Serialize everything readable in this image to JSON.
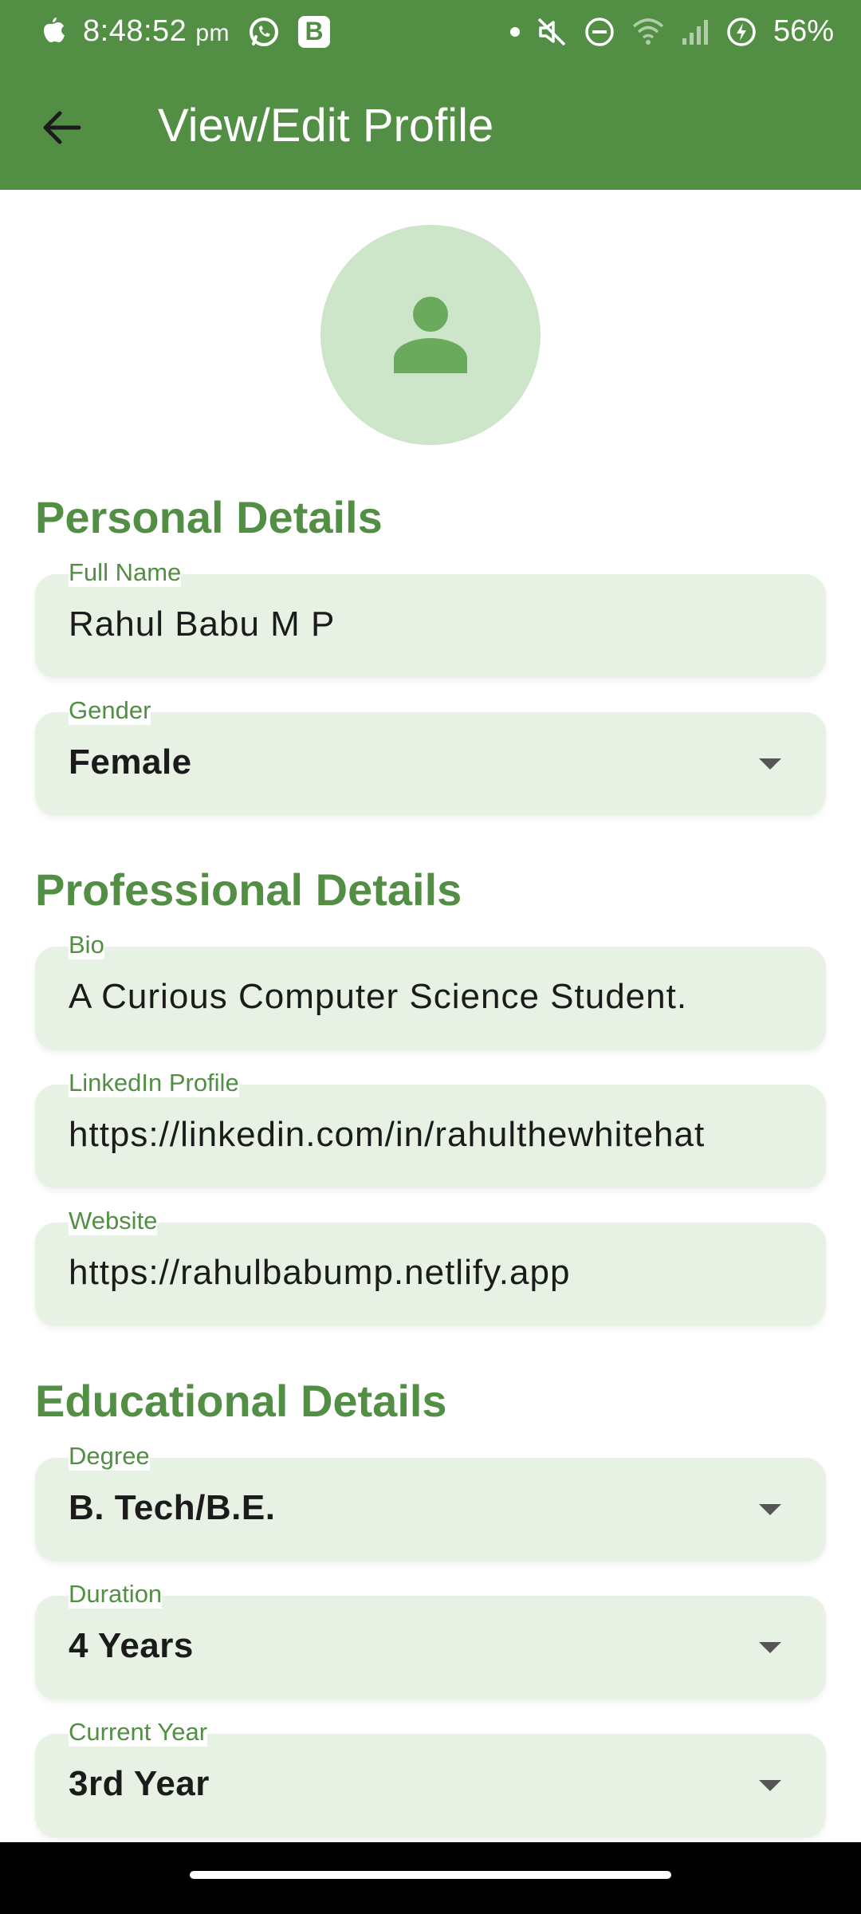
{
  "status_bar": {
    "time": "8:48:52",
    "ampm": "pm",
    "app_badge": "B",
    "battery": "56%"
  },
  "app_bar": {
    "title": "View/Edit Profile"
  },
  "sections": {
    "personal": {
      "title": "Personal Details",
      "full_name": {
        "label": "Full Name",
        "value": "Rahul Babu M P"
      },
      "gender": {
        "label": "Gender",
        "value": "Female"
      }
    },
    "professional": {
      "title": "Professional Details",
      "bio": {
        "label": "Bio",
        "value": "A Curious Computer Science Student."
      },
      "linkedin": {
        "label": "LinkedIn Profile",
        "value": "https://linkedin.com/in/rahulthewhitehat"
      },
      "website": {
        "label": "Website",
        "value": "https://rahulbabump.netlify.app"
      }
    },
    "educational": {
      "title": "Educational Details",
      "degree": {
        "label": "Degree",
        "value": "B. Tech/B.E."
      },
      "duration": {
        "label": "Duration",
        "value": "4 Years"
      },
      "current_year": {
        "label": "Current Year",
        "value": "3rd Year"
      }
    }
  },
  "colors": {
    "primary": "#528f44",
    "field_bg": "#e7f2e4",
    "avatar_bg": "#cde5c8",
    "avatar_icon": "#6aaa5c"
  },
  "icons": {
    "back": "arrow-back-icon",
    "avatar": "person-icon",
    "dropdown": "chevron-down-icon"
  }
}
